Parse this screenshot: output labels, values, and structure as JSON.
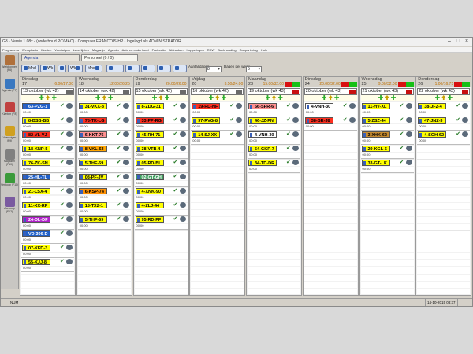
{
  "window": {
    "title": "G3 - Versie 1.08x - (onderhoud PC/MAC) - Computer FRANCOIS-HP - Ingelogd als ADMINISTRATOR"
  },
  "menu": [
    "Programma",
    "Werkplaats",
    "Klanten",
    "Voertuigen",
    "Leverlijsten",
    "Magazijn",
    "Agenda",
    "Auto en onderhoud",
    "Facturatie",
    "Afdrukken",
    "Koppelingen",
    "RDW",
    "Boekhouding",
    "Rapportering",
    "Hulp"
  ],
  "tabs": {
    "agenda": "Agenda",
    "personeel": "Personeel (0 / 0)"
  },
  "toolbar": {
    "mnd_label": "Mnd",
    "wk_label": "Wk",
    "wk2_label": "Wk",
    "mnd2_label": "Mnd",
    "aantal_label": "Aantal dagen",
    "aantal_value": "8",
    "dagen_label": "Dagen per week",
    "dagen_value": "5"
  },
  "sidebar": [
    {
      "label": "Werkbonnen (F6)"
    },
    {
      "label": "Agenda (F7)"
    },
    {
      "label": "Klanten (F8)"
    },
    {
      "label": "Voertuigen (F9)"
    },
    {
      "label": "Magazijn (F10)"
    },
    {
      "label": "Verkoop (F11)"
    },
    {
      "label": "Aankoop (F12)"
    }
  ],
  "days": [
    {
      "name": "Dinsdag",
      "num": "17",
      "time": "6.00/27.00",
      "week": "13 oktober (wk 42)",
      "badge_color": "grey",
      "cards": [
        {
          "plate": "63-PZG-1",
          "color": "#2060c8",
          "fg": "#ffffff",
          "time": "00:00"
        },
        {
          "plate": "8-BSB-BB",
          "color": "#ffff00",
          "fg": "#000000",
          "time": "00:00"
        },
        {
          "plate": "82-VL-VJ",
          "color": "#ff3020",
          "fg": "#000000",
          "time": "00:00"
        },
        {
          "plate": "18-KNP-5",
          "color": "#ffff00",
          "fg": "#000000",
          "time": "00:00"
        },
        {
          "plate": "76-ZK-SN",
          "color": "#ffff00",
          "fg": "#000000",
          "time": "00:00"
        },
        {
          "plate": "25-HL-TL",
          "color": "#2060c8",
          "fg": "#ffffff",
          "time": "00:00"
        },
        {
          "plate": "21-LSX-4",
          "color": "#ffff00",
          "fg": "#000000",
          "time": "00:00"
        },
        {
          "plate": "11-XX-RP",
          "color": "#ffff00",
          "fg": "#000000",
          "time": "00:00"
        },
        {
          "plate": "24-DL-DF",
          "color": "#b020c8",
          "fg": "#ffffff",
          "time": "00:00"
        },
        {
          "plate": "VD-306-D",
          "color": "#2060c8",
          "fg": "#ffffff",
          "time": "00:00"
        },
        {
          "plate": "07-KFD-3",
          "color": "#ffff00",
          "fg": "#000000",
          "time": "00:00"
        },
        {
          "plate": "55-KJJ-8",
          "color": "#ffff00",
          "fg": "#000000",
          "time": "00:00"
        }
      ]
    },
    {
      "name": "Woensdag",
      "num": "18",
      "time": "12.00/26.25",
      "week": "14 oktober (wk 42)",
      "badge_color": "grey",
      "cards": [
        {
          "plate": "31-VKX-8",
          "color": "#ffff00",
          "fg": "#000000",
          "time": "00:00"
        },
        {
          "plate": "78-TK-LG",
          "color": "#ff3020",
          "fg": "#000000",
          "time": "00:00"
        },
        {
          "plate": "6-KKT-76",
          "color": "#ff9090",
          "fg": "#000000",
          "time": "00:00"
        },
        {
          "plate": "8-VKL-63",
          "color": "#ffa500",
          "fg": "#000000",
          "time": "00:00"
        },
        {
          "plate": "5-THF-69",
          "color": "#ffff00",
          "fg": "#000000",
          "time": "00:00"
        },
        {
          "plate": "08-PF-JV",
          "color": "#ffff00",
          "fg": "#000000",
          "time": "00:00"
        },
        {
          "plate": "6-KSP-74",
          "color": "#ff9000",
          "fg": "#000000",
          "time": "00:00"
        },
        {
          "plate": "18-TXZ-1",
          "color": "#ffff00",
          "fg": "#000000",
          "time": "00:00"
        },
        {
          "plate": "5-THF-69",
          "color": "#ffff00",
          "fg": "#000000",
          "time": "00:00"
        }
      ]
    },
    {
      "name": "Donderdag",
      "num": "19",
      "time": "20.00/26.00",
      "week": "15 oktober (wk 42)",
      "badge_color": "grey",
      "cards": [
        {
          "plate": "8-ZDG-31",
          "color": "#ffff00",
          "fg": "#000000",
          "time": "00:00"
        },
        {
          "plate": "33-PP-RG",
          "color": "#ff3020",
          "fg": "#000000",
          "time": "00:00"
        },
        {
          "plate": "45-RH-71",
          "color": "#ffff00",
          "fg": "#000000",
          "time": "00:00"
        },
        {
          "plate": "38-VTB-4",
          "color": "#ffff00",
          "fg": "#000000",
          "time": "00:00"
        },
        {
          "plate": "05-RD-BL",
          "color": "#ffff00",
          "fg": "#000000",
          "time": "00:00"
        },
        {
          "plate": "02-GT-GH",
          "color": "#40a060",
          "fg": "#ffffff",
          "time": "00:00"
        },
        {
          "plate": "4-XNK-90",
          "color": "#ffff00",
          "fg": "#000000",
          "time": "00:00"
        },
        {
          "plate": "4-ZLJ-44",
          "color": "#ffff00",
          "fg": "#000000",
          "time": "00:00"
        },
        {
          "plate": "95-RD-PF",
          "color": "#ffff00",
          "fg": "#000000",
          "time": "00:00"
        }
      ]
    },
    {
      "name": "Vrijdag",
      "num": "20",
      "time": "3.50/24.00",
      "week": "16 oktober (wk 42)",
      "badge_color": "grey",
      "cards": [
        {
          "plate": "19-RD-NF",
          "color": "#ff3020",
          "fg": "#000000",
          "time": "00:00"
        },
        {
          "plate": "97-RVG-8",
          "color": "#ffff00",
          "fg": "#000000",
          "time": "00:00"
        },
        {
          "plate": "14-SJ-XX",
          "color": "#ffff00",
          "fg": "#000000",
          "time": "00:00"
        }
      ]
    },
    {
      "name": "Maandag",
      "num": "23",
      "time": "15.00/32.00",
      "week": "19 oktober (wk 43)",
      "badge_color": "red",
      "cards": [
        {
          "plate": "56-SPR-6",
          "color": "#ff9090",
          "fg": "#000000",
          "time": "00:00"
        },
        {
          "plate": "46-JZ-PN",
          "color": "#ffff00",
          "fg": "#000000",
          "time": "00:00"
        },
        {
          "plate": "4-VNH-30",
          "color": "#ffffff",
          "fg": "#000000",
          "time": "00:00"
        },
        {
          "plate": "54-GKP-7",
          "color": "#ffff00",
          "fg": "#000000",
          "time": "00:00"
        },
        {
          "plate": "34-TD-DR",
          "color": "#ffff00",
          "fg": "#000000",
          "time": "00:00"
        }
      ]
    },
    {
      "name": "Dinsdag",
      "num": "24",
      "time": "20.00/32.00",
      "week": "20 oktober (wk 43)",
      "badge_color": "red",
      "cards": [
        {
          "plate": "4-VNH-30",
          "color": "#ffffff",
          "fg": "#000000",
          "time": "00:00"
        },
        {
          "plate": "38-BR-J8",
          "color": "#ff3020",
          "fg": "#000000",
          "time": "00:00"
        }
      ]
    },
    {
      "name": "Woensdag",
      "num": "25",
      "time": "9.00/32.00",
      "week": "21 oktober (wk 43)",
      "badge_color": "red",
      "cards": [
        {
          "plate": "11-HV-XL",
          "color": "#ffff00",
          "fg": "#000000",
          "time": "00:00"
        },
        {
          "plate": "5-ZSZ-44",
          "color": "#ffff00",
          "fg": "#000000",
          "time": "00:00"
        },
        {
          "plate": "3-XHK-62",
          "color": "#c88c30",
          "fg": "#000000",
          "time": "00:00"
        },
        {
          "plate": "29-KGL-6",
          "color": "#ffff00",
          "fg": "#000000",
          "time": "00:00"
        },
        {
          "plate": "33-GT-LK",
          "color": "#ffff00",
          "fg": "#000000",
          "time": "00:00"
        }
      ]
    },
    {
      "name": "Donderdag",
      "num": "26",
      "time": "1.00/16.75",
      "week": "22 oktober (wk 43)",
      "badge_color": "red",
      "cards": [
        {
          "plate": "38-JFZ-4",
          "color": "#ffff00",
          "fg": "#000000",
          "time": "00:00"
        },
        {
          "plate": "47-JNZ-3",
          "color": "#ffff00",
          "fg": "#000000",
          "time": "00:00"
        },
        {
          "plate": "4-SGH-62",
          "color": "#ffff00",
          "fg": "#000000",
          "time": "00:00"
        }
      ]
    }
  ],
  "status": {
    "mode": "NUM",
    "datetime": "14-10-2015 08:37"
  }
}
